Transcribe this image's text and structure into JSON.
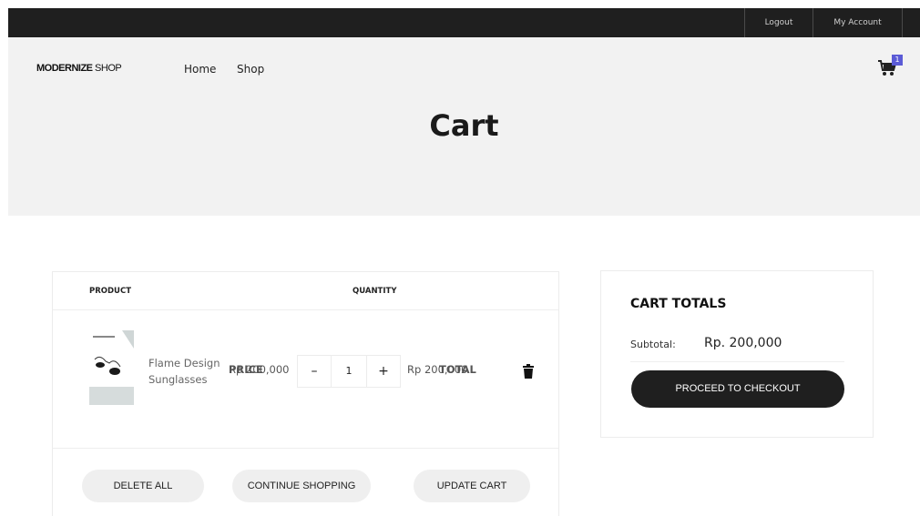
{
  "topbar": {
    "logout_label": "Logout",
    "account_label": "My Account"
  },
  "header": {
    "logo_bold": "MODERNIZE",
    "logo_light": " SHOP",
    "nav": {
      "home": "Home",
      "shop": "Shop"
    },
    "cart_count": "1",
    "page_title": "Cart"
  },
  "cart_table": {
    "columns": {
      "product": "PRODUCT",
      "price": "PRICE",
      "quantity": "QUANTITY",
      "total": "TOTAL"
    },
    "items": [
      {
        "name_line1": "Flame Design",
        "name_line2": "Sunglasses",
        "price": "Rp 200,000",
        "quantity": "1",
        "total": "Rp 200,000",
        "thumbnail_icon": "sunglasses-product-image"
      }
    ],
    "actions": {
      "delete_all": "DELETE ALL",
      "continue_shopping": "CONTINUE SHOPPING",
      "update_cart": "UPDATE CART"
    }
  },
  "cart_totals": {
    "title": "CART TOTALS",
    "subtotal_label": "Subtotal:",
    "subtotal_value": "Rp. 200,000",
    "checkout_label": "PROCEED TO CHECKOUT"
  },
  "colors": {
    "topbar": "#1f1f1f",
    "hero_bg": "#f2f2f2",
    "badge": "#5b5bd6",
    "checkout_button": "#1f1f1f",
    "pill_button": "#efefef"
  }
}
